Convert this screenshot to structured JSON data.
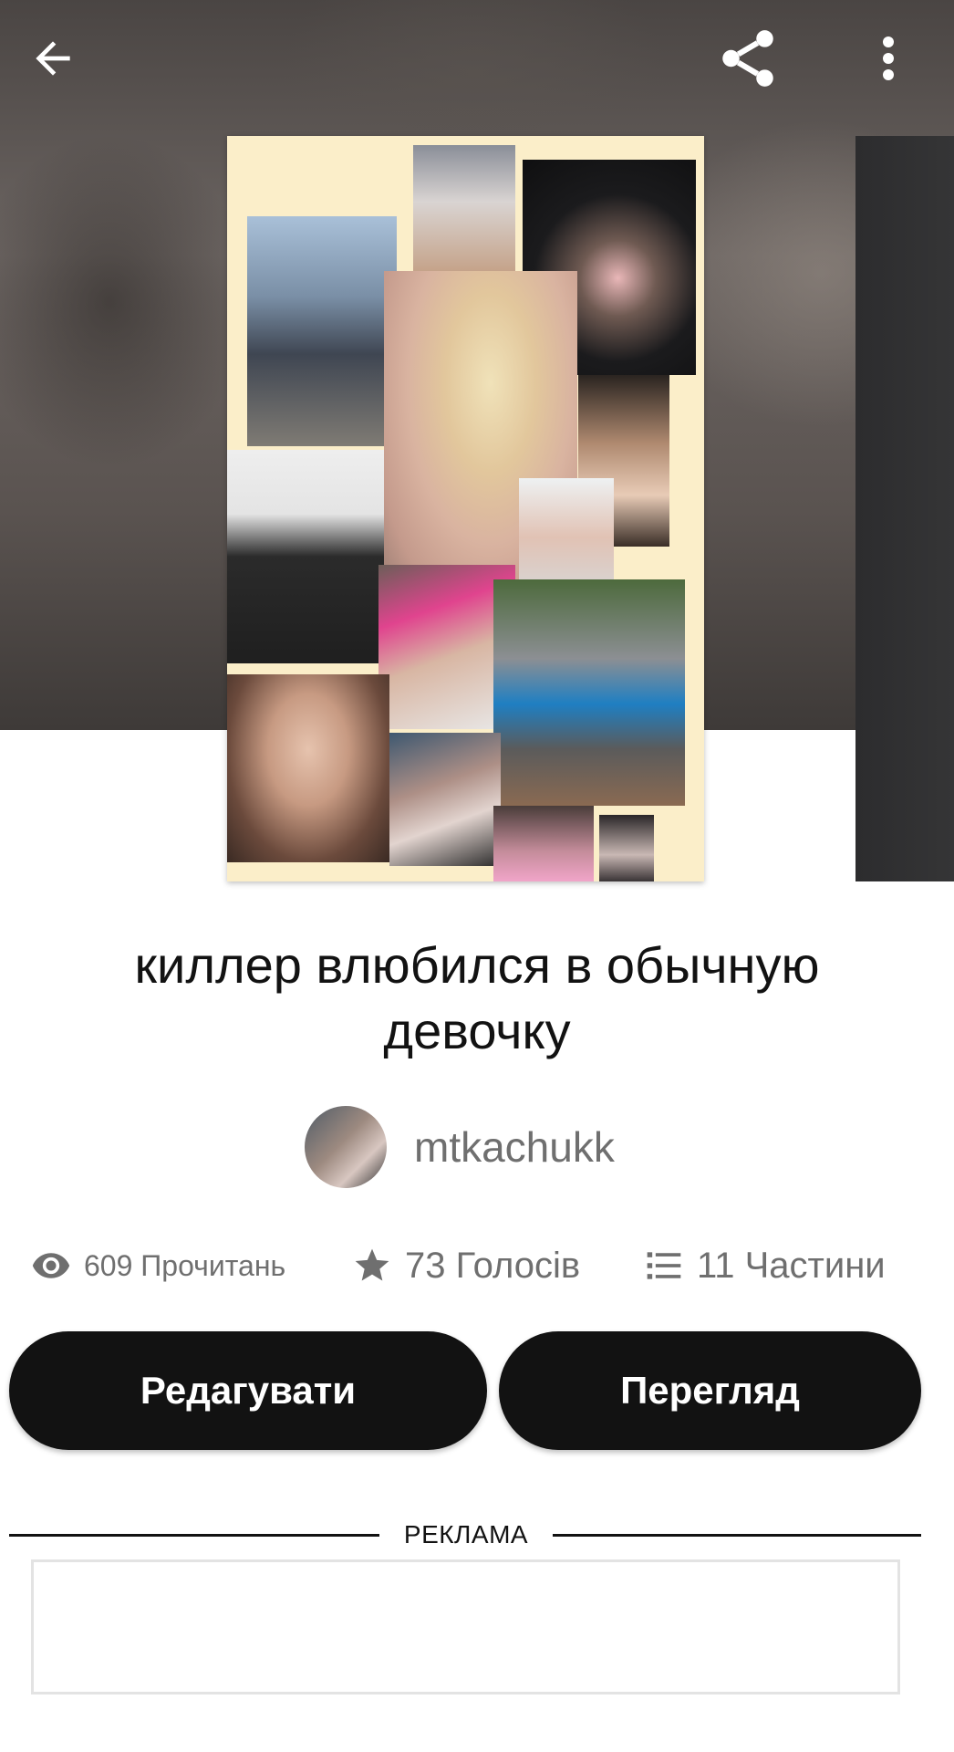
{
  "story": {
    "title": "киллер влюбился в обычную девочку",
    "author": "mtkachukk"
  },
  "stats": {
    "reads": "609 Прочитань",
    "votes": "73 Голосів",
    "parts": "11 Частини"
  },
  "actions": {
    "edit_label": "Редагувати",
    "preview_label": "Перегляд"
  },
  "ad": {
    "label": "РЕКЛАМА"
  },
  "icons": {
    "back": "arrow-left-icon",
    "share": "share-icon",
    "more": "more-vertical-icon",
    "reads": "eye-icon",
    "votes": "star-icon",
    "parts": "list-icon"
  },
  "colors": {
    "button_bg": "#121212",
    "button_text": "#ffffff",
    "secondary_text": "#6f6f6f",
    "cover_bg": "#fbeec9"
  }
}
